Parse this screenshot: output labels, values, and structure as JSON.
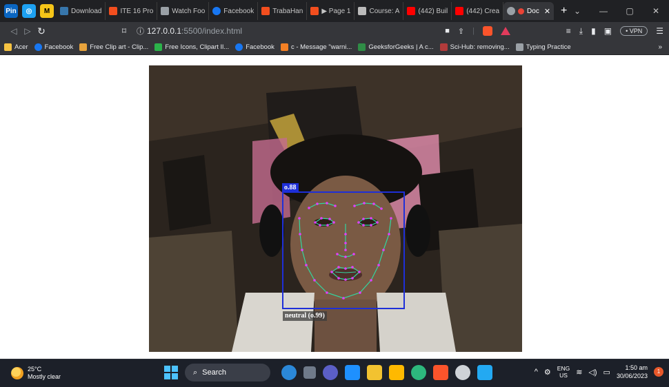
{
  "browser": {
    "tabs": [
      {
        "label": "Download",
        "color": "#3776ab"
      },
      {
        "label": "ITE 16 Pro",
        "color": "#f24e1e"
      },
      {
        "label": "Watch Foo",
        "color": "#9aa0a6"
      },
      {
        "label": "Facebook",
        "color": "#1877f2"
      },
      {
        "label": "TrabaHan",
        "color": "#f24e1e"
      },
      {
        "label": "▶ Page 1",
        "color": "#f24e1e"
      },
      {
        "label": "Course: A",
        "color": "#bbbbbb"
      },
      {
        "label": "(442) Buil",
        "color": "#ff0000"
      },
      {
        "label": "(442) Crea",
        "color": "#ff0000"
      }
    ],
    "active_tab": {
      "label": "Doc"
    },
    "url_host": "127.0.0.1",
    "url_path": ":5500/index.html",
    "vpn_label": "• VPN"
  },
  "bookmarks": [
    {
      "label": "Acer",
      "color": "#f6c342"
    },
    {
      "label": "Facebook",
      "color": "#1877f2"
    },
    {
      "label": "Free Clip art - Clip...",
      "color": "#e8a33c"
    },
    {
      "label": "Free Icons, Clipart Il...",
      "color": "#2bb34a"
    },
    {
      "label": "Facebook",
      "color": "#1877f2"
    },
    {
      "label": "c - Message \"warni...",
      "color": "#f48024"
    },
    {
      "label": "GeeksforGeeks | A c...",
      "color": "#2f8d46"
    },
    {
      "label": "Sci-Hub: removing...",
      "color": "#b23b3b"
    },
    {
      "label": "Typing Practice",
      "color": "#9aa0a6"
    }
  ],
  "detection": {
    "score": "o.88",
    "expression": "neutral (o.99)"
  },
  "taskbar": {
    "temperature": "25°C",
    "weather": "Mostly clear",
    "search_label": "Search",
    "lang_top": "ENG",
    "lang_bottom": "US",
    "time": "1:50 am",
    "date": "30/06/2023",
    "notifications": "1"
  }
}
